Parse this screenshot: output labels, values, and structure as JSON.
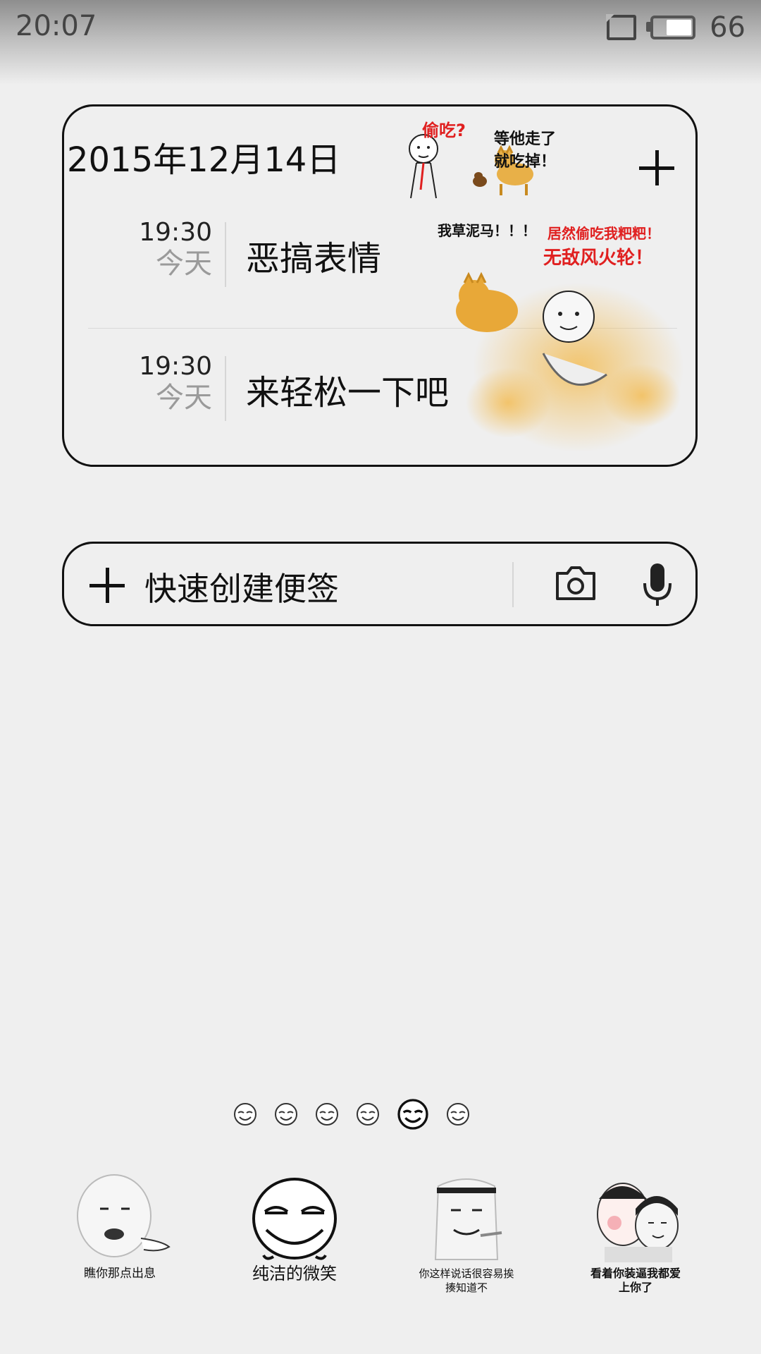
{
  "status_bar": {
    "time": "20:07",
    "battery_level": "66"
  },
  "widget": {
    "date": "2015年12月14日",
    "add_button": "add-icon",
    "items": [
      {
        "time": "19:30",
        "day": "今天",
        "title": "恶搞表情"
      },
      {
        "time": "19:30",
        "day": "今天",
        "title": "来轻松一下吧"
      }
    ],
    "meme_top": {
      "caption_left": "偷吃?",
      "caption_right": "等他走了就吃掉！"
    },
    "meme_big": {
      "text_left": "我草泥马！！！",
      "text_right_1": "居然偷吃我粑粑！",
      "text_right_2": "无敌风火轮！"
    }
  },
  "quick_note": {
    "label": "快速创建便签",
    "camera": "camera-icon",
    "voice": "microphone-icon"
  },
  "page_indicator": {
    "count": 6,
    "active_index": 4
  },
  "dock": [
    {
      "label": "瞧你那点出息"
    },
    {
      "label": "纯洁的微笑"
    },
    {
      "label": "你这样说话很容易挨揍知道不"
    },
    {
      "label": "看着你装逼我都爱上你了"
    }
  ]
}
